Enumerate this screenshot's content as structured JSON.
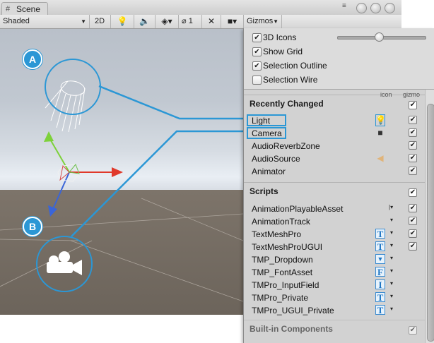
{
  "window": {
    "tab_title": "Scene",
    "tab_icon": "grid-icon",
    "menu_icon": "menu-lines-icon"
  },
  "toolbar": {
    "shading_mode": "Shaded",
    "mode_2d": "2D",
    "hidden_count": "1",
    "gizmos_label": "Gizmos",
    "icons": [
      "light-bulb-icon",
      "audio-speaker-icon",
      "effects-icon",
      "visibility-icon",
      "move-tool-icon",
      "camera-icon"
    ]
  },
  "callouts": {
    "a": "A",
    "b": "B"
  },
  "gizmos_panel": {
    "options": [
      {
        "label": "3D Icons",
        "checked": true
      },
      {
        "label": "Show Grid",
        "checked": true
      },
      {
        "label": "Selection Outline",
        "checked": true
      },
      {
        "label": "Selection Wire",
        "checked": false
      }
    ],
    "icon_size_slider": 0.47,
    "columns": {
      "icon": "icon",
      "gizmo": "gizmo"
    },
    "sections": {
      "recently_changed": {
        "title": "Recently Changed",
        "checked": true,
        "items": [
          {
            "name": "Light",
            "icon": "light-bulb-icon",
            "gizmo": true,
            "highlighted": true
          },
          {
            "name": "Camera",
            "icon": "camera-icon",
            "gizmo": true,
            "highlighted": true
          },
          {
            "name": "AudioReverbZone",
            "icon": "",
            "gizmo": true
          },
          {
            "name": "AudioSource",
            "icon": "audio-speaker-icon",
            "gizmo": true
          },
          {
            "name": "Animator",
            "icon": "",
            "gizmo": true
          }
        ]
      },
      "scripts": {
        "title": "Scripts",
        "checked": true,
        "items": [
          {
            "name": "AnimationPlayableAsset",
            "icon": "dropdown-arrow-icon",
            "gizmo": true
          },
          {
            "name": "AnimationTrack",
            "icon": "dropdown-arrow-icon",
            "gizmo": true
          },
          {
            "name": "TextMeshPro",
            "icon": "T",
            "gizmo": true
          },
          {
            "name": "TextMeshProUGUI",
            "icon": "T",
            "gizmo": true
          },
          {
            "name": "TMP_Dropdown",
            "icon": "▼",
            "gizmo": false
          },
          {
            "name": "TMP_FontAsset",
            "icon": "F",
            "gizmo": false
          },
          {
            "name": "TMPro_InputField",
            "icon": "I",
            "gizmo": false
          },
          {
            "name": "TMPro_Private",
            "icon": "T",
            "gizmo": false
          },
          {
            "name": "TMPro_UGUI_Private",
            "icon": "T",
            "gizmo": false
          }
        ]
      },
      "builtin": {
        "title": "Built-in Components",
        "checked": true
      }
    }
  }
}
